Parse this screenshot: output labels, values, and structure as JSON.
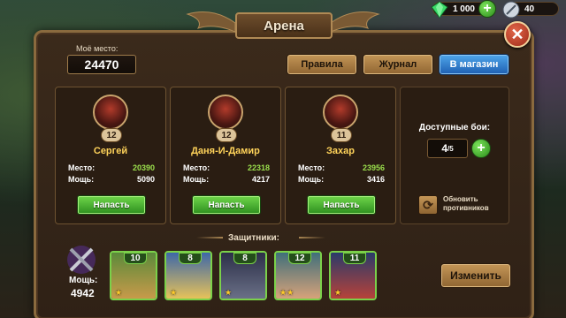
{
  "currency": {
    "gems": "1 000",
    "energy": "40"
  },
  "title": "Арена",
  "my_place": {
    "label": "Моё место:",
    "value": "24470"
  },
  "buttons": {
    "rules": "Правила",
    "journal": "Журнал",
    "shop": "В магазин",
    "change": "Изменить",
    "close": "✕"
  },
  "opponents": [
    {
      "name": "Сергей",
      "level": "12",
      "place_label": "Место:",
      "place": "20390",
      "power_label": "Мощь:",
      "power": "5090",
      "attack": "Напасть"
    },
    {
      "name": "Даня-И-Дамир",
      "level": "12",
      "place_label": "Место:",
      "place": "22318",
      "power_label": "Мощь:",
      "power": "4217",
      "attack": "Напасть"
    },
    {
      "name": "Захар",
      "level": "11",
      "place_label": "Место:",
      "place": "23956",
      "power_label": "Мощь:",
      "power": "3416",
      "attack": "Напасть"
    }
  ],
  "fights": {
    "label": "Доступные бои:",
    "current": "4",
    "max": "/5"
  },
  "refresh": {
    "line1": "Обновить",
    "line2": "противников"
  },
  "defenders": {
    "label": "Защитники:",
    "power_label": "Мощь:",
    "power": "4942",
    "heroes": [
      {
        "level": "10",
        "stars": "★",
        "color_top": "#5b8a3a",
        "color_bottom": "#c89a4a"
      },
      {
        "level": "8",
        "stars": "★",
        "color_top": "#3d67a8",
        "color_bottom": "#e6c25a"
      },
      {
        "level": "8",
        "stars": "★",
        "color_top": "#2c2f48",
        "color_bottom": "#6a7087"
      },
      {
        "level": "12",
        "stars": "★★",
        "color_top": "#3f6f7a",
        "color_bottom": "#d7a27a"
      },
      {
        "level": "11",
        "stars": "★",
        "color_top": "#2a3b6a",
        "color_bottom": "#b7423a"
      }
    ]
  }
}
